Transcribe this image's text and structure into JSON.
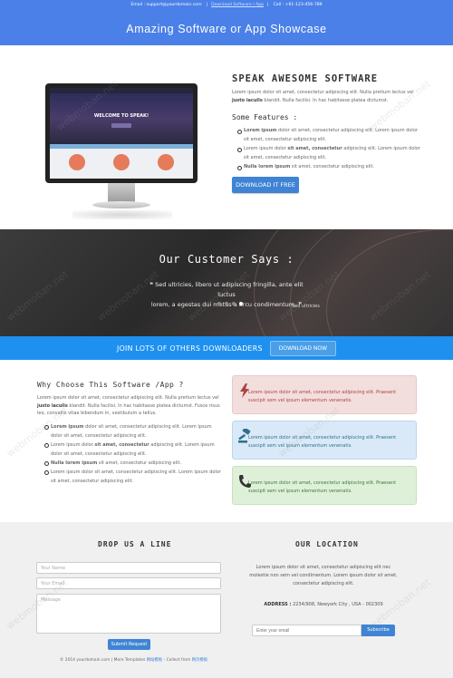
{
  "topbar": {
    "email": "Email : support@yourdomain.com",
    "sep1": "|",
    "download_link": "Download Software / App",
    "sep2": "|",
    "call": "Call : +61-123-456-789"
  },
  "hero": {
    "title": "Amazing Software or App Showcase"
  },
  "software": {
    "screen_title": "WELCOME TO SPEAK!",
    "title": "SPEAK AWESOME SOFTWARE",
    "intro_pre": "Lorem ipsum dolor sit amet, consectetur adipiscing elit. Nulla pretium lectus vel ",
    "intro_bold": "justo iaculis",
    "intro_post": " blandit. Nulla facilisi. In hac habitasse platea dictumst.",
    "features_title": "Some Features :",
    "features": [
      {
        "bold": "Lorem ipsum",
        "text": " dolor sit amet, consectetur adipiscing elit. Lorem ipsum dolor sit amet, consectetur adipiscing elit."
      },
      {
        "bold": "",
        "text": "Lorem ipsum dolor ",
        "bold2": "sit amet, consectetur",
        "text2": " adipiscing elit. Lorem ipsum dolor sit amet, consectetur adipiscing elit."
      },
      {
        "bold": "Nulla lorem ipsum",
        "text": " sit amet, consectetur adipiscing elit."
      }
    ],
    "download_button": "DOWNLOAD IT FREE"
  },
  "testimonial": {
    "title": "Our Customer Says :",
    "open_quote": "❝",
    "quote_line1": "Sed ultricies, libero ut adipiscing fringilla, ante elit luctus",
    "quote_line2": "lorem, a egestas dui metus a arcu condimentum.",
    "close_quote": "❞",
    "author": "Sed ultricies"
  },
  "join": {
    "text": "JOIN LOTS OF OTHERS DOWNLOADERS",
    "button": "DOWNLOAD NOW"
  },
  "why": {
    "title": "Why Choose This Software /App ?",
    "intro_pre": "Lorem ipsum dolor sit amet, consectetur adipiscing elit. Nulla pretium lectus vel ",
    "intro_bold": "justo iaculis",
    "intro_post": " blandit. Nulla facilisi. In hac habitasse platea dictumst. Fusce risus leo, convallis vitae bibendum in, vestibulum a tellus.",
    "items": [
      {
        "bold": "Lorem ipsum",
        "text": " dolor sit amet, consectetur adipiscing elit. Lorem ipsum dolor sit amet, consectetur adipiscing elit."
      },
      {
        "pre": "Lorem ipsum dolor ",
        "bold": "sit amet, consectetur",
        "text": " adipiscing elit. Lorem ipsum dolor sit amet, consectetur adipiscing elit."
      },
      {
        "bold": "Nulla lorem ipsum",
        "text": " sit amet, consectetur adipiscing elit."
      },
      {
        "bold": "",
        "text": "Lorem ipsum dolor sit amet, consectetur adipiscing elit. Lorem ipsum dolor sit amet, consectetur adipiscing elit."
      }
    ]
  },
  "boxes": [
    {
      "text": "Lorem ipsum dolor sit amet, consectetur adipiscing elit. Praesent suscipit sem vel ipsum elementum venenatis.",
      "icon": "lightning-icon",
      "color": "#a94442"
    },
    {
      "text": "Lorem ipsum dolor sit amet, consectetur adipiscing elit. Praesent suscipit sem vel ipsum elementum venenatis.",
      "icon": "gavel-icon",
      "color": "#31708f"
    },
    {
      "text": "Lorem ipsum dolor sit amet, consectetur adipiscing elit. Praesent suscipit sem vel ipsum elementum venenatis.",
      "icon": "phone-icon",
      "color": "#3c763d"
    }
  ],
  "contact": {
    "title": "DROP US A LINE",
    "name_placeholder": "Your Name",
    "email_placeholder": "Your Email",
    "message_placeholder": "Message",
    "submit": "Submit Request"
  },
  "location": {
    "title": "OUR LOCATION",
    "text": "Lorem ipsum dolor sit amet, consectetur adipiscing elit nec molestie non sem vel condimentum. Lorem ipsum dolor sit amet, consectetur adipiscing elit.",
    "address_label": "ADDRESS :",
    "address": " 2234/908, Newyork City , USA - 002309",
    "newsletter_placeholder": "Enter your email",
    "subscribe": "Subscribe"
  },
  "footer": {
    "copyright": "© 2014 yourdomain.com | More Templates ",
    "link1": "网站模板",
    "mid": " - Collect from ",
    "link2": "网页模板"
  },
  "watermark": "webmoban.net"
}
